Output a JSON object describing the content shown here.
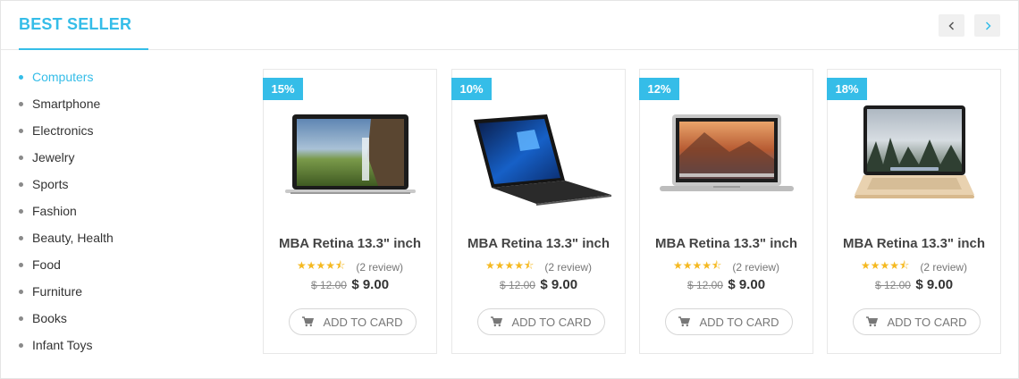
{
  "header": {
    "title": "BEST SELLER",
    "prev_icon": "chevron-left-icon",
    "next_icon": "chevron-right-icon"
  },
  "colors": {
    "accent": "#35bde8",
    "star": "#f5b921"
  },
  "categories": [
    {
      "label": "Computers",
      "active": true
    },
    {
      "label": "Smartphone",
      "active": false
    },
    {
      "label": "Electronics",
      "active": false
    },
    {
      "label": "Jewelry",
      "active": false
    },
    {
      "label": "Sports",
      "active": false
    },
    {
      "label": "Fashion",
      "active": false
    },
    {
      "label": "Beauty, Health",
      "active": false
    },
    {
      "label": "Food",
      "active": false
    },
    {
      "label": "Furniture",
      "active": false
    },
    {
      "label": "Books",
      "active": false
    },
    {
      "label": "Infant Toys",
      "active": false
    }
  ],
  "products": [
    {
      "discount": "15%",
      "name": "MBA Retina 13.3\" inch",
      "rating": 4.5,
      "stars": "★★★★⯪",
      "reviews": "(2 review)",
      "old_price": "$ 12.00",
      "price": "$ 9.00",
      "button": "ADD TO CARD",
      "image": "macbook-pro-waterfall-image"
    },
    {
      "discount": "10%",
      "name": "MBA Retina 13.3\" inch",
      "rating": 4.5,
      "stars": "★★★★⯪",
      "reviews": "(2 review)",
      "old_price": "$ 12.00",
      "price": "$ 9.00",
      "button": "ADD TO CARD",
      "image": "dell-windows-laptop-image"
    },
    {
      "discount": "12%",
      "name": "MBA Retina 13.3\" inch",
      "rating": 4.5,
      "stars": "★★★★⯪",
      "reviews": "(2 review)",
      "old_price": "$ 12.00",
      "price": "$ 9.00",
      "button": "ADD TO CARD",
      "image": "macbook-air-el-capitan-image"
    },
    {
      "discount": "18%",
      "name": "MBA Retina 13.3\" inch",
      "rating": 4.5,
      "stars": "★★★★⯪",
      "reviews": "(2 review)",
      "old_price": "$ 12.00",
      "price": "$ 9.00",
      "button": "ADD TO CARD",
      "image": "macbook-gold-yosemite-image"
    }
  ]
}
